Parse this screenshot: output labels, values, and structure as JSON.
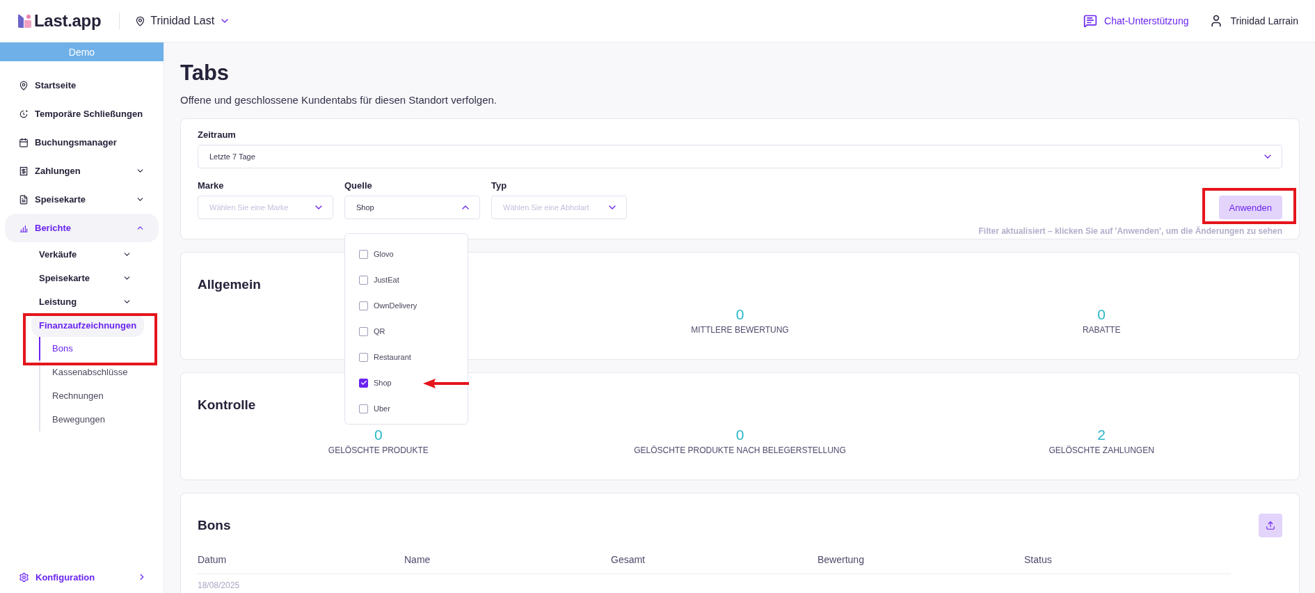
{
  "header": {
    "logo": "Last.app",
    "location": "Trinidad Last",
    "chat": "Chat-Unterstützung",
    "user": "Trinidad Larrain"
  },
  "sidebar": {
    "banner": "Demo",
    "items": [
      {
        "label": "Startseite",
        "kind": "link",
        "selected": false
      },
      {
        "label": "Temporäre Schließungen",
        "kind": "link",
        "selected": false
      },
      {
        "label": "Buchungsmanager",
        "kind": "link",
        "selected": false
      },
      {
        "label": "Zahlungen",
        "kind": "group",
        "expanded": false,
        "selected": false
      },
      {
        "label": "Speisekarte",
        "kind": "group",
        "expanded": false,
        "selected": false
      },
      {
        "label": "Berichte",
        "kind": "group",
        "expanded": true,
        "selected": true,
        "children": [
          {
            "label": "Verkäufe",
            "kind": "group",
            "expanded": false,
            "selected": false
          },
          {
            "label": "Speisekarte",
            "kind": "group",
            "expanded": false,
            "selected": false
          },
          {
            "label": "Leistung",
            "kind": "group",
            "expanded": false,
            "selected": false
          },
          {
            "label": "Finanzaufzeichnungen",
            "kind": "group",
            "expanded": true,
            "selected": true,
            "highlighted": true,
            "children": [
              {
                "label": "Bons",
                "kind": "link",
                "selected": true
              },
              {
                "label": "Kassenabschlüsse",
                "kind": "link",
                "selected": false
              },
              {
                "label": "Rechnungen",
                "kind": "link",
                "selected": false
              },
              {
                "label": "Bewegungen",
                "kind": "link",
                "selected": false
              }
            ]
          }
        ]
      }
    ],
    "footer": {
      "label": "Konfiguration"
    }
  },
  "page": {
    "title": "Tabs",
    "subtitle": "Offene und geschlossene Kundentabs für diesen Standort verfolgen."
  },
  "filters": {
    "period": {
      "label": "Zeitraum",
      "value": "Letzte 7 Tage"
    },
    "selects": [
      {
        "label": "Marke",
        "placeholder": "Wählen Sie eine Marke",
        "expanded": false
      },
      {
        "label": "Quelle",
        "value": "Shop",
        "expanded": true,
        "options": [
          {
            "label": "Glovo",
            "checked": false
          },
          {
            "label": "JustEat",
            "checked": false
          },
          {
            "label": "OwnDelivery",
            "checked": false
          },
          {
            "label": "QR",
            "checked": false
          },
          {
            "label": "Restaurant",
            "checked": false
          },
          {
            "label": "Shop",
            "checked": true,
            "pointed": true
          },
          {
            "label": "Uber",
            "checked": false
          }
        ]
      },
      {
        "label": "Typ",
        "placeholder": "Wählen Sie eine Abholart",
        "expanded": false
      }
    ],
    "apply": {
      "label": "Anwenden",
      "highlighted": true
    },
    "hint": "Filter aktualisiert – klicken Sie auf 'Anwenden', um die Änderungen zu sehen"
  },
  "sections": [
    {
      "title": "Allgemein",
      "stats": [
        {
          "value": "0",
          "label": "MITTLERE BEWERTUNG"
        },
        {
          "value": "0",
          "label": "RABATTE"
        }
      ]
    },
    {
      "title": "Kontrolle",
      "stats": [
        {
          "value": "0",
          "label": "GELÖSCHTE PRODUKTE"
        },
        {
          "value": "0",
          "label": "GELÖSCHTE PRODUKTE NACH BELEGERSTELLUNG"
        },
        {
          "value": "2",
          "label": "GELÖSCHTE ZAHLUNGEN"
        }
      ]
    }
  ],
  "table": {
    "title": "Bons",
    "columns": [
      "Datum",
      "Name",
      "Gesamt",
      "Bewertung",
      "Status"
    ],
    "rows": [
      [
        "18/08/2025"
      ]
    ]
  }
}
